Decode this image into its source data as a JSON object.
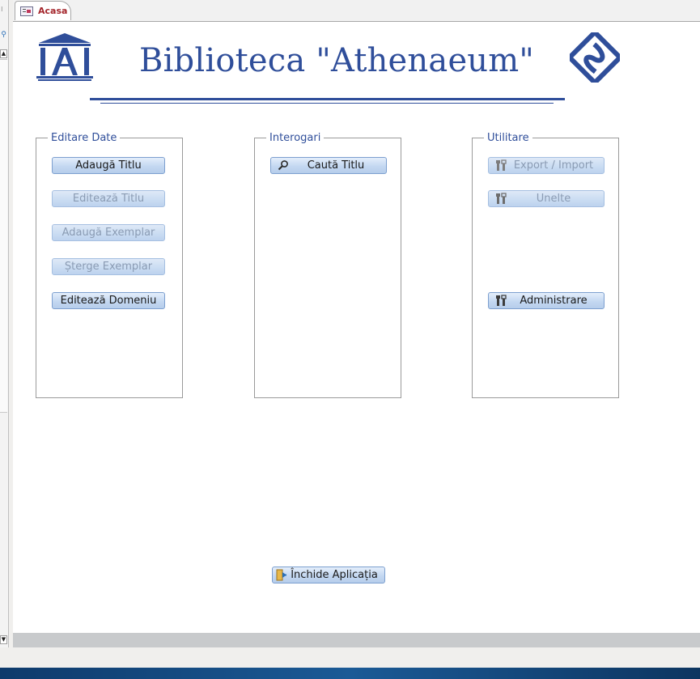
{
  "tab": {
    "label": "Acasa"
  },
  "header": {
    "title": "Biblioteca \"Athenaeum\""
  },
  "groups": {
    "editare": {
      "label": "Editare Date",
      "buttons": [
        "Adaugă Titlu",
        "Editează Titlu",
        "Adaugă Exemplar",
        "Șterge Exemplar",
        "Editează Domeniu"
      ]
    },
    "interogari": {
      "label": "Interogari",
      "buttons": [
        "Caută Titlu"
      ]
    },
    "utilitare": {
      "label": "Utilitare",
      "buttons": [
        "Export / Import",
        "Unelte",
        "Administrare"
      ]
    }
  },
  "close_button": {
    "label": "Închide Aplicația"
  },
  "colors": {
    "accent": "#2f4e9a",
    "tab_text": "#a4262c",
    "button_face": "#c4d8f1"
  }
}
